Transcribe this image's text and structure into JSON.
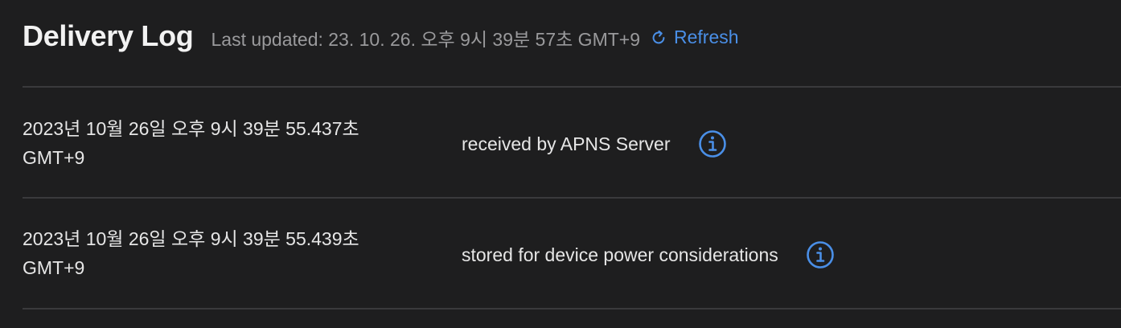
{
  "header": {
    "title": "Delivery Log",
    "last_updated": "Last updated: 23. 10. 26. 오후 9시 39분 57초 GMT+9",
    "refresh_label": "Refresh",
    "refresh_icon": "refresh-icon"
  },
  "entries": [
    {
      "timestamp_line1": "2023년 10월 26일 오후 9시 39분 55.437초",
      "timestamp_line2": "GMT+9",
      "status": "received by APNS Server",
      "info_icon": "info-icon"
    },
    {
      "timestamp_line1": "2023년 10월 26일 오후 9시 39분 55.439초",
      "timestamp_line2": "GMT+9",
      "status": "stored for device power considerations",
      "info_icon": "info-icon"
    }
  ],
  "colors": {
    "background": "#1e1e1f",
    "accent": "#4a8fe7",
    "muted_text": "#9a9a9c",
    "divider": "#3a3a3c"
  }
}
